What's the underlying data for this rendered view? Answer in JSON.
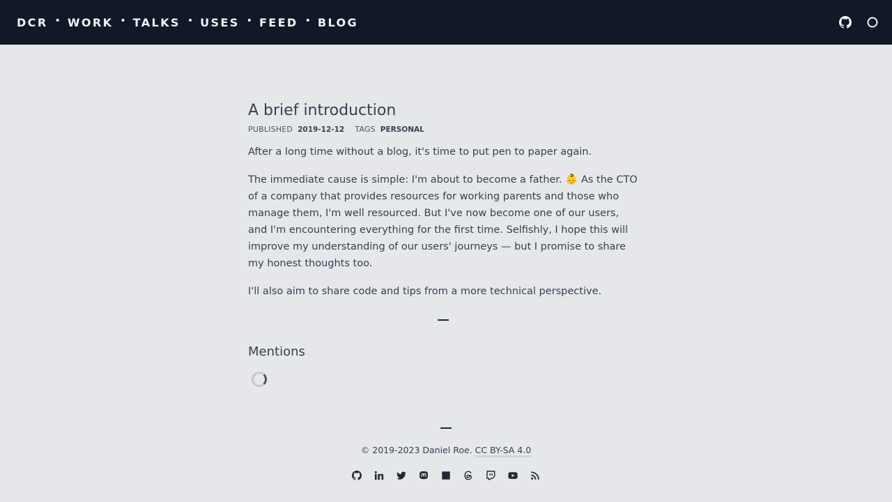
{
  "nav": {
    "items": [
      "DCR",
      "WORK",
      "TALKS",
      "USES",
      "FEED",
      "BLOG"
    ],
    "separator": "•"
  },
  "header": {
    "icons": [
      "github-icon",
      "theme-toggle-icon"
    ]
  },
  "post": {
    "title": "A brief introduction",
    "published_label": "PUBLISHED",
    "published_date": "2019-12-12",
    "tags_label": "TAGS",
    "tag": "PERSONAL",
    "paragraphs": [
      "After a long time without a blog, it's time to put pen to paper again.",
      "The immediate cause is simple: I'm about to become a father. 👶 As the CTO of a company that provides resources for working parents and those who manage them, I'm well resourced. But I've now become one of our users, and I'm encountering everything for the first time. Selfishly, I hope this will improve my understanding of our users' journeys — but I promise to share my honest thoughts too.",
      "I'll also aim to share code and tips from a more technical perspective."
    ]
  },
  "mentions": {
    "title": "Mentions"
  },
  "footer": {
    "copyright": "© 2019-2023 Daniel Roe.",
    "license": "CC BY-SA 4.0",
    "socials": [
      "github-icon",
      "linkedin-icon",
      "twitter-icon",
      "mastodon-icon",
      "bluesky-square-icon",
      "threads-icon",
      "twitch-icon",
      "youtube-icon",
      "rss-icon"
    ]
  },
  "colors": {
    "header_bg": "#111827",
    "page_bg": "#e5e7eb",
    "text": "#374151"
  }
}
